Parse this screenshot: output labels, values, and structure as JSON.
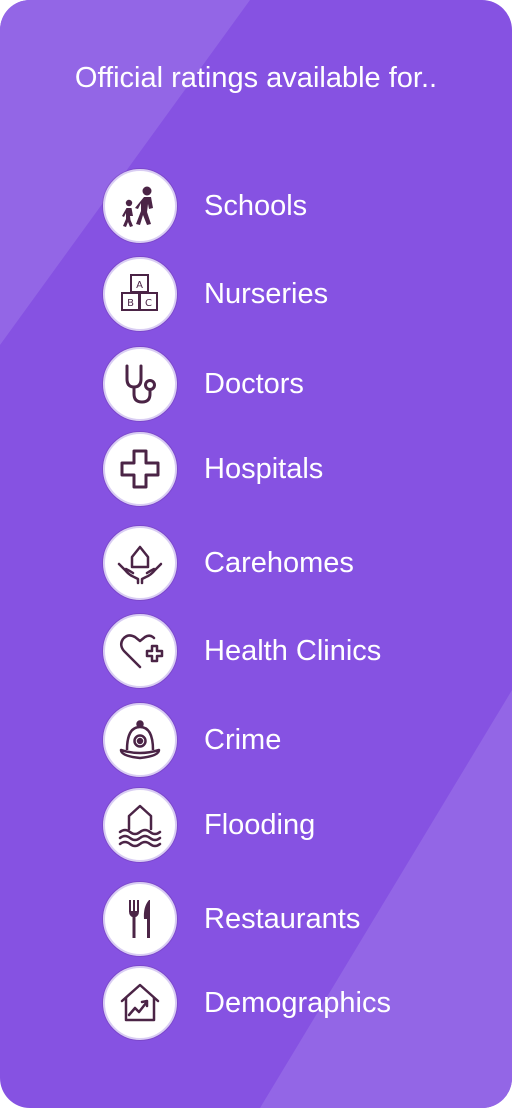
{
  "title": "Official ratings available for..",
  "colors": {
    "background": "#8652e2",
    "background_light": "#9366e6",
    "icon_stroke": "#4b2446",
    "text": "#ffffff"
  },
  "items": [
    {
      "label": "Schools",
      "icon": "schools-icon"
    },
    {
      "label": "Nurseries",
      "icon": "nurseries-icon"
    },
    {
      "label": "Doctors",
      "icon": "doctors-icon"
    },
    {
      "label": "Hospitals",
      "icon": "hospitals-icon"
    },
    {
      "label": "Carehomes",
      "icon": "carehomes-icon"
    },
    {
      "label": "Health Clinics",
      "icon": "health-clinics-icon"
    },
    {
      "label": "Crime",
      "icon": "crime-icon"
    },
    {
      "label": "Flooding",
      "icon": "flooding-icon"
    },
    {
      "label": "Restaurants",
      "icon": "restaurants-icon"
    },
    {
      "label": "Demographics",
      "icon": "demographics-icon"
    }
  ],
  "nursery_blocks": [
    "A",
    "B",
    "C"
  ]
}
